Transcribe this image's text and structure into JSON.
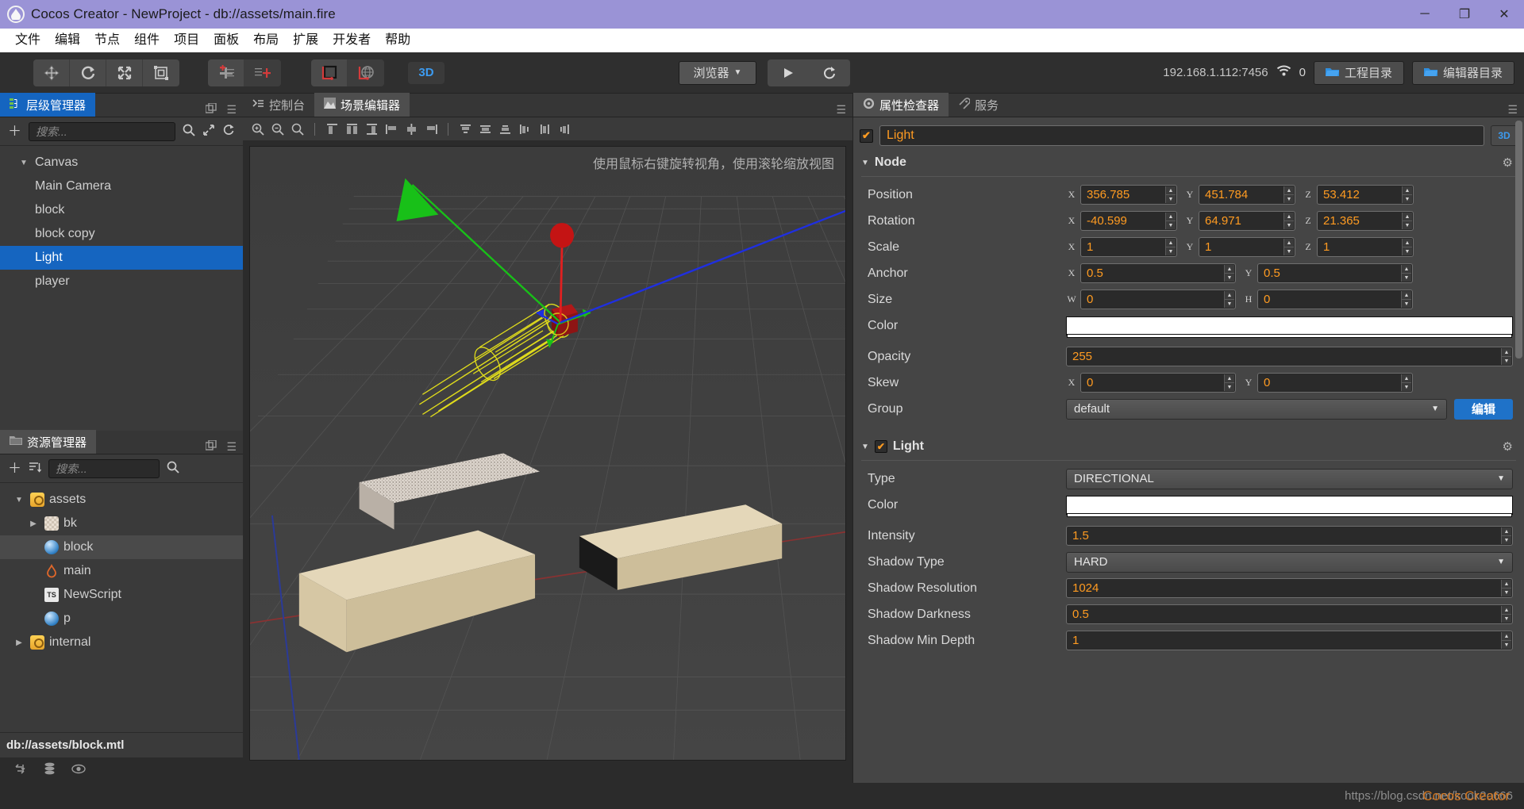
{
  "titlebar": {
    "title": "Cocos Creator - NewProject - db://assets/main.fire",
    "app_icon": "cocos-logo-icon",
    "minimize": "─",
    "maximize": "❐",
    "close": "✕"
  },
  "menubar": {
    "items": [
      {
        "label": "文件"
      },
      {
        "label": "编辑"
      },
      {
        "label": "节点"
      },
      {
        "label": "组件"
      },
      {
        "label": "项目"
      },
      {
        "label": "面板"
      },
      {
        "label": "布局"
      },
      {
        "label": "扩展"
      },
      {
        "label": "开发者"
      },
      {
        "label": "帮助"
      }
    ]
  },
  "toolbar": {
    "transform_tools": [
      {
        "name": "move-tool",
        "glyph": "✥"
      },
      {
        "name": "rotate-tool",
        "glyph": "↻"
      },
      {
        "name": "scale-tool",
        "glyph": "⤡"
      },
      {
        "name": "rect-tool",
        "glyph": "▣"
      }
    ],
    "pivot_tools": [
      {
        "name": "pivot-center-tool",
        "glyph": "✛"
      },
      {
        "name": "pivot-pos-tool",
        "glyph": "✣"
      }
    ],
    "coord_tools": [
      {
        "name": "local-coord-tool",
        "glyph": "┗"
      },
      {
        "name": "global-coord-tool",
        "glyph": "☸"
      }
    ],
    "mode_3d_label": "3D",
    "preview_select": "浏览器",
    "preview_caret": "▼",
    "play_glyph": "▶",
    "refresh_glyph": "⟳",
    "ip_address": "192.168.1.112:7456",
    "wifi_icon": "wifi-icon",
    "device_count": "0",
    "project_dir_label": "工程目录",
    "editor_dir_label": "编辑器目录"
  },
  "hierarchy": {
    "tab_label": "层级管理器",
    "tab_icon": "hierarchy-icon",
    "add_glyph": "＋",
    "search_placeholder": "搜索...",
    "search_glyph": "⌕",
    "expand_glyph": "⤢",
    "refresh_glyph": "⟳",
    "nodes": [
      {
        "label": "Canvas",
        "depth": 0,
        "caret": "▼",
        "selected": false
      },
      {
        "label": "Main Camera",
        "depth": 1,
        "caret": "",
        "selected": false
      },
      {
        "label": "block",
        "depth": 1,
        "caret": "",
        "selected": false
      },
      {
        "label": "block copy",
        "depth": 1,
        "caret": "",
        "selected": false
      },
      {
        "label": "Light",
        "depth": 1,
        "caret": "",
        "selected": true
      },
      {
        "label": "player",
        "depth": 1,
        "caret": "",
        "selected": false
      }
    ]
  },
  "assets": {
    "tab_label": "资源管理器",
    "tab_icon": "folder-icon",
    "add_glyph": "＋",
    "sort_glyph": "☰",
    "search_placeholder": "搜索...",
    "search_glyph": "⌕",
    "items": [
      {
        "label": "assets",
        "depth": 0,
        "caret": "▼",
        "icon": "folder",
        "highlight": false
      },
      {
        "label": "bk",
        "depth": 1,
        "caret": "▶",
        "icon": "texture",
        "highlight": false
      },
      {
        "label": "block",
        "depth": 1,
        "caret": "",
        "icon": "material",
        "highlight": true
      },
      {
        "label": "main",
        "depth": 1,
        "caret": "",
        "icon": "scene",
        "highlight": false
      },
      {
        "label": "NewScript",
        "depth": 1,
        "caret": "",
        "icon": "typescript",
        "highlight": false
      },
      {
        "label": "p",
        "depth": 1,
        "caret": "",
        "icon": "material",
        "highlight": false
      },
      {
        "label": "internal",
        "depth": 0,
        "caret": "▶",
        "icon": "folder",
        "highlight": false
      }
    ],
    "status_path": "db://assets/block.mtl",
    "status_icons": [
      {
        "name": "sync-icon",
        "glyph": "⇄"
      },
      {
        "name": "database-icon",
        "glyph": "≣"
      },
      {
        "name": "eye-icon",
        "glyph": "◉"
      }
    ]
  },
  "scene": {
    "tabs": [
      {
        "label": "控制台",
        "icon": "console-icon",
        "active": false
      },
      {
        "label": "场景编辑器",
        "icon": "scene-icon",
        "active": true
      }
    ],
    "menu_glyph": "☰",
    "toolbar_icons": [
      {
        "name": "zoom-in-icon",
        "glyph": "⊕"
      },
      {
        "name": "zoom-out-icon",
        "glyph": "⊖"
      },
      {
        "name": "zoom-fit-icon",
        "glyph": "⌕"
      },
      {
        "name": "align-left-icon",
        "glyph": "⌶"
      },
      {
        "name": "align-h-center-icon",
        "glyph": "⌷"
      },
      {
        "name": "align-right-icon",
        "glyph": "⌸"
      },
      {
        "name": "align-top-icon",
        "glyph": "⌹"
      },
      {
        "name": "align-v-center-icon",
        "glyph": "⌺"
      },
      {
        "name": "align-bottom-icon",
        "glyph": "⌻"
      },
      {
        "name": "dist-top-icon",
        "glyph": "▤"
      },
      {
        "name": "dist-middle-icon",
        "glyph": "▥"
      },
      {
        "name": "dist-bottom-icon",
        "glyph": "▦"
      },
      {
        "name": "dist-left-icon",
        "glyph": "▧"
      },
      {
        "name": "dist-center-icon",
        "glyph": "▨"
      },
      {
        "name": "dist-right-icon",
        "glyph": "▩"
      }
    ],
    "hint": "使用鼠标右键旋转视角，使用滚轮缩放视图",
    "gizmo": {
      "x_axis_color": "#e02020",
      "y_axis_color": "#18c018",
      "z_axis_color": "#1f2fe0",
      "light_wire_color": "#e8e41a"
    }
  },
  "inspector": {
    "tabs": [
      {
        "label": "属性检查器",
        "icon": "gear-icon",
        "active": true
      },
      {
        "label": "服务",
        "icon": "service-icon",
        "active": false
      }
    ],
    "menu_glyph": "☰",
    "node_enabled": true,
    "node_name": "Light",
    "mode_3d_label": "3D",
    "node_section": {
      "title": "Node",
      "caret": "▼",
      "gear": "⚙",
      "position": {
        "label": "Position",
        "x": "356.785",
        "y": "451.784",
        "z": "53.412"
      },
      "rotation": {
        "label": "Rotation",
        "x": "-40.599",
        "y": "64.971",
        "z": "21.365"
      },
      "scale": {
        "label": "Scale",
        "x": "1",
        "y": "1",
        "z": "1"
      },
      "anchor": {
        "label": "Anchor",
        "x": "0.5",
        "y": "0.5"
      },
      "size": {
        "label": "Size",
        "w": "0",
        "h": "0"
      },
      "color": {
        "label": "Color",
        "value": "#ffffff"
      },
      "opacity": {
        "label": "Opacity",
        "value": "255"
      },
      "skew": {
        "label": "Skew",
        "x": "0",
        "y": "0"
      },
      "group": {
        "label": "Group",
        "value": "default",
        "edit_label": "编辑"
      },
      "axis_x": "X",
      "axis_y": "Y",
      "axis_z": "Z",
      "axis_w": "W",
      "axis_h": "H"
    },
    "light_section": {
      "title": "Light",
      "caret": "▼",
      "enabled": true,
      "gear": "⚙",
      "type": {
        "label": "Type",
        "value": "DIRECTIONAL"
      },
      "color": {
        "label": "Color",
        "value": "#ffffff"
      },
      "intensity": {
        "label": "Intensity",
        "value": "1.5"
      },
      "shadow_type": {
        "label": "Shadow Type",
        "value": "HARD"
      },
      "shadow_resolution": {
        "label": "Shadow Resolution",
        "value": "1024"
      },
      "shadow_darkness": {
        "label": "Shadow Darkness",
        "value": "0.5"
      },
      "shadow_min_depth": {
        "label": "Shadow Min Depth",
        "value": "1"
      }
    }
  },
  "footer": {
    "watermark": "https://blog.csdn.net/kook2o666",
    "watermark_overlay": "Cocos Creator"
  }
}
